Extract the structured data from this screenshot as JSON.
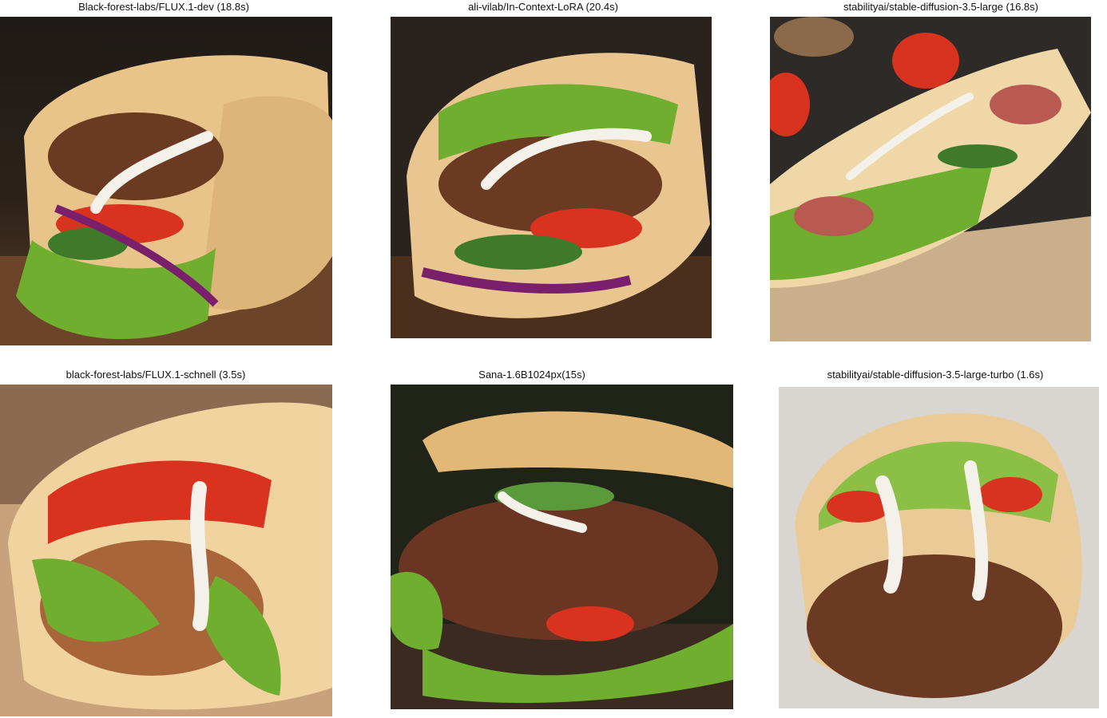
{
  "grid": [
    {
      "caption": "Black-forest-labs/FLUX.1-dev (18.8s)",
      "image": "food-photo-wrap-on-wooden-board"
    },
    {
      "caption": "ali-vilab/In-Context-LoRA (20.4s)",
      "image": "food-photo-pita-pocket-with-meat"
    },
    {
      "caption": "stabilityai/stable-diffusion-3.5-large (16.8s)",
      "image": "food-photo-flatbread-on-parchment"
    },
    {
      "caption": "black-forest-labs/FLUX.1-schnell (3.5s)",
      "image": "food-photo-rolled-wrap-closeup"
    },
    {
      "caption": "Sana-1.6B1024px(15s)",
      "image": "food-photo-pita-with-beef-strips"
    },
    {
      "caption": "stabilityai/stable-diffusion-3.5-large-turbo (1.6s)",
      "image": "food-photo-pita-grey-background"
    }
  ],
  "colors": {
    "bread": "#e8c48a",
    "bread_dark": "#b8874a",
    "meat": "#6b3a22",
    "lettuce": "#6fae2f",
    "tomato": "#d9321f",
    "cabbage": "#7a1f6b",
    "cucumber": "#3f7a2a",
    "sauce": "#f4f1ea",
    "wood": "#5a3a22"
  }
}
